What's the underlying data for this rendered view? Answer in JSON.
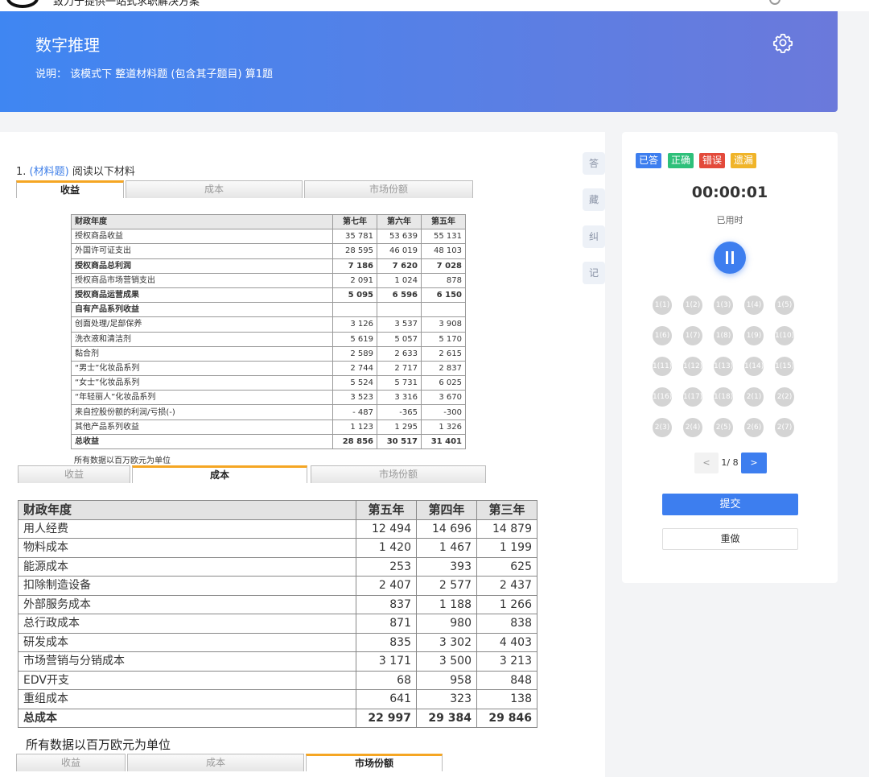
{
  "topbar": {
    "slogan": "致力于提供一站式求职解决方案"
  },
  "header": {
    "title": "数字推理",
    "desc_label": "说明：",
    "desc_text": "该模式下 整道材料题 (包含其子题目) 算1题"
  },
  "question": {
    "number": "1.",
    "tag": "(材料题)",
    "prompt": "阅读以下材料"
  },
  "tabs": {
    "t1": "收益",
    "t2": "成本",
    "t3": "市场份额"
  },
  "table1": {
    "headers": [
      "财政年度",
      "第七年",
      "第六年",
      "第五年"
    ],
    "rows": [
      {
        "label": "授权商品收益",
        "v": [
          "35 781",
          "53 639",
          "55 131"
        ],
        "bold": false
      },
      {
        "label": "外国许可证支出",
        "v": [
          "28 595",
          "46 019",
          "48 103"
        ],
        "bold": false
      },
      {
        "label": "授权商品总利润",
        "v": [
          "7 186",
          "7 620",
          "7 028"
        ],
        "bold": true
      },
      {
        "label": "授权商品市场营销支出",
        "v": [
          "2 091",
          "1 024",
          "878"
        ],
        "bold": false
      },
      {
        "label": "授权商品运营成果",
        "v": [
          "5 095",
          "6 596",
          "6 150"
        ],
        "bold": true
      },
      {
        "label": "自有产品系列收益",
        "v": [
          "",
          "",
          ""
        ],
        "bold": true
      },
      {
        "label": "创面处理/足部保养",
        "v": [
          "3 126",
          "3 537",
          "3 908"
        ],
        "bold": false
      },
      {
        "label": "洗衣液和清洁剂",
        "v": [
          "5 619",
          "5 057",
          "5 170"
        ],
        "bold": false
      },
      {
        "label": "黏合剂",
        "v": [
          "2 589",
          "2 633",
          "2 615"
        ],
        "bold": false
      },
      {
        "label": "“男士”化妆品系列",
        "v": [
          "2 744",
          "2 717",
          "2 837"
        ],
        "bold": false
      },
      {
        "label": "“女士”化妆品系列",
        "v": [
          "5 524",
          "5 731",
          "6 025"
        ],
        "bold": false
      },
      {
        "label": "“年轻丽人”化妆品系列",
        "v": [
          "3 523",
          "3 316",
          "3 670"
        ],
        "bold": false
      },
      {
        "label": "来自控股份额的利润/亏损(-)",
        "v": [
          "- 487",
          "-365",
          "-300"
        ],
        "bold": false
      },
      {
        "label": "其他产品系列收益",
        "v": [
          "1 123",
          "1 295",
          "1 326"
        ],
        "bold": false
      },
      {
        "label": "总收益",
        "v": [
          "28 856",
          "30 517",
          "31 401"
        ],
        "bold": true
      }
    ],
    "note": "所有数据以百万欧元为单位"
  },
  "table2": {
    "headers": [
      "财政年度",
      "第五年",
      "第四年",
      "第三年"
    ],
    "rows": [
      {
        "label": "用人经费",
        "v": [
          "12 494",
          "14 696",
          "14 879"
        ],
        "bold": false
      },
      {
        "label": "物料成本",
        "v": [
          "1 420",
          "1 467",
          "1 199"
        ],
        "bold": false
      },
      {
        "label": "能源成本",
        "v": [
          "253",
          "393",
          "625"
        ],
        "bold": false
      },
      {
        "label": "扣除制造设备",
        "v": [
          "2 407",
          "2 577",
          "2 437"
        ],
        "bold": false
      },
      {
        "label": "外部服务成本",
        "v": [
          "837",
          "1 188",
          "1 266"
        ],
        "bold": false
      },
      {
        "label": "总行政成本",
        "v": [
          "871",
          "980",
          "838"
        ],
        "bold": false
      },
      {
        "label": "研发成本",
        "v": [
          "835",
          "3 302",
          "4 403"
        ],
        "bold": false
      },
      {
        "label": "市场营销与分销成本",
        "v": [
          "3 171",
          "3 500",
          "3 213"
        ],
        "bold": false
      },
      {
        "label": "EDV开支",
        "v": [
          "68",
          "958",
          "848"
        ],
        "bold": false
      },
      {
        "label": "重组成本",
        "v": [
          "641",
          "323",
          "138"
        ],
        "bold": false
      },
      {
        "label": "总成本",
        "v": [
          "22 997",
          "29 384",
          "29 846"
        ],
        "bold": true
      }
    ],
    "note": "所有数据以百万欧元为单位"
  },
  "side_tools": {
    "answer": "答",
    "collect": "藏",
    "correct": "纠",
    "note": "记"
  },
  "panel": {
    "legend": [
      {
        "label": "已答",
        "color": "#3d7eef"
      },
      {
        "label": "正确",
        "color": "#2ec07a"
      },
      {
        "label": "错误",
        "color": "#e34a3b"
      },
      {
        "label": "遗漏",
        "color": "#f0b429"
      }
    ],
    "timer": "00:00:01",
    "timer_label": "已用时",
    "questions": [
      "1(1)",
      "1(2)",
      "1(3)",
      "1(4)",
      "1(5)",
      "1(6)",
      "1(7)",
      "1(8)",
      "1(9)",
      "1(10)",
      "1(11)",
      "1(12)",
      "1(13)",
      "1(14)",
      "1(15)",
      "1(16)",
      "1(17)",
      "1(18)",
      "2(1)",
      "2(2)",
      "2(3)",
      "2(4)",
      "2(5)",
      "2(6)",
      "2(7)"
    ],
    "pager": {
      "prev": "<",
      "text": "1/ 8",
      "next": ">"
    },
    "submit": "提交",
    "redo": "重做"
  }
}
